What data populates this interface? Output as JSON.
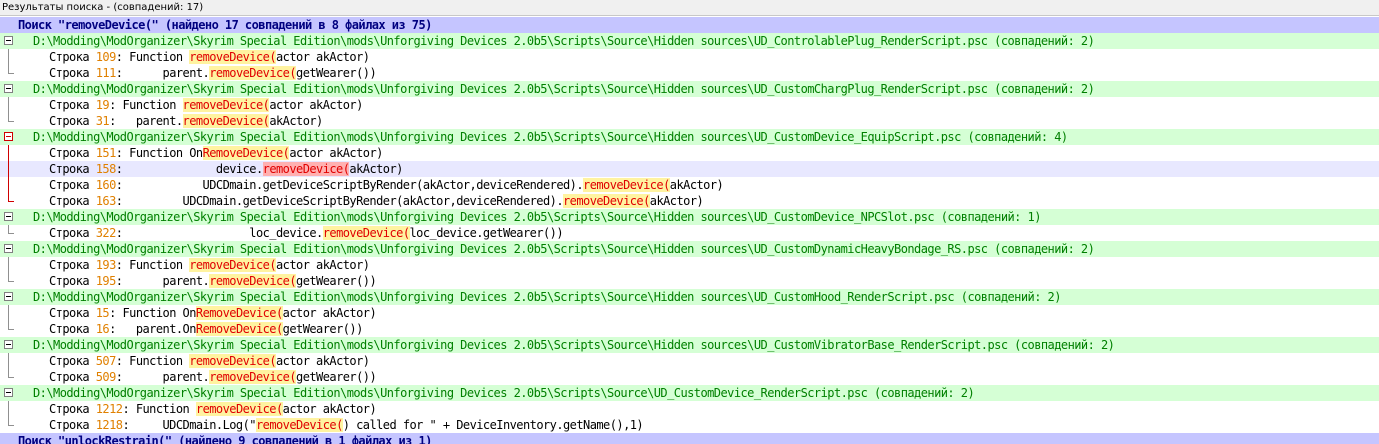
{
  "window": {
    "title": "Результаты поиска - (совпадений: 17)"
  },
  "line_label": "Строка",
  "searches": [
    {
      "header": "Поиск \"removeDevice(\" (найдено 17 совпадений в 8 файлах из 75)",
      "files": [
        {
          "path": "D:\\Modding\\ModOrganizer\\Skyrim Special Edition\\mods\\Unforgiving Devices 2.0b5\\Scripts\\Source\\Hidden sources\\UD_ControlablePlug_RenderScript.psc (совпадений: 2)",
          "hits": [
            {
              "line": "109",
              "pre": "Function ",
              "match": "removeDevice(",
              "post": "actor akActor)"
            },
            {
              "line": "111",
              "pre": "     parent.",
              "match": "removeDevice(",
              "post": "getWearer())"
            }
          ]
        },
        {
          "path": "D:\\Modding\\ModOrganizer\\Skyrim Special Edition\\mods\\Unforgiving Devices 2.0b5\\Scripts\\Source\\Hidden sources\\UD_CustomChargPlug_RenderScript.psc (совпадений: 2)",
          "hits": [
            {
              "line": "19",
              "pre": "Function ",
              "match": "removeDevice(",
              "post": "actor akActor)"
            },
            {
              "line": "31",
              "pre": "  parent.",
              "match": "removeDevice(",
              "post": "akActor)"
            }
          ]
        },
        {
          "path": "D:\\Modding\\ModOrganizer\\Skyrim Special Edition\\mods\\Unforgiving Devices 2.0b5\\Scripts\\Source\\Hidden sources\\UD_CustomDevice_EquipScript.psc (совпадений: 4)",
          "expanded_marker": "red",
          "hits": [
            {
              "line": "151",
              "pre": "Function On",
              "match": "RemoveDevice(",
              "post": "actor akActor)"
            },
            {
              "line": "158",
              "pre": "             device.",
              "match": "removeDevice(",
              "post": "akActor)",
              "selected": true
            },
            {
              "line": "160",
              "pre": "           UDCDmain.getDeviceScriptByRender(akActor,deviceRendered).",
              "match": "removeDevice(",
              "post": "akActor)"
            },
            {
              "line": "163",
              "pre": "        UDCDmain.getDeviceScriptByRender(akActor,deviceRendered).",
              "match": "removeDevice(",
              "post": "akActor)"
            }
          ]
        },
        {
          "path": "D:\\Modding\\ModOrganizer\\Skyrim Special Edition\\mods\\Unforgiving Devices 2.0b5\\Scripts\\Source\\Hidden sources\\UD_CustomDevice_NPCSlot.psc (совпадений: 1)",
          "hits": [
            {
              "line": "322",
              "pre": "                  loc_device.",
              "match": "removeDevice(",
              "post": "loc_device.getWearer())"
            }
          ]
        },
        {
          "path": "D:\\Modding\\ModOrganizer\\Skyrim Special Edition\\mods\\Unforgiving Devices 2.0b5\\Scripts\\Source\\Hidden sources\\UD_CustomDynamicHeavyBondage_RS.psc (совпадений: 2)",
          "hits": [
            {
              "line": "193",
              "pre": "Function ",
              "match": "removeDevice(",
              "post": "actor akActor)"
            },
            {
              "line": "195",
              "pre": "     parent.",
              "match": "removeDevice(",
              "post": "getWearer())"
            }
          ]
        },
        {
          "path": "D:\\Modding\\ModOrganizer\\Skyrim Special Edition\\mods\\Unforgiving Devices 2.0b5\\Scripts\\Source\\Hidden sources\\UD_CustomHood_RenderScript.psc (совпадений: 2)",
          "hits": [
            {
              "line": "15",
              "pre": "Function On",
              "match": "RemoveDevice(",
              "post": "actor akActor)"
            },
            {
              "line": "16",
              "pre": "  parent.On",
              "match": "RemoveDevice(",
              "post": "getWearer())"
            }
          ]
        },
        {
          "path": "D:\\Modding\\ModOrganizer\\Skyrim Special Edition\\mods\\Unforgiving Devices 2.0b5\\Scripts\\Source\\Hidden sources\\UD_CustomVibratorBase_RenderScript.psc (совпадений: 2)",
          "hits": [
            {
              "line": "507",
              "pre": "Function ",
              "match": "removeDevice(",
              "post": "actor akActor)"
            },
            {
              "line": "509",
              "pre": "     parent.",
              "match": "removeDevice(",
              "post": "getWearer())"
            }
          ]
        },
        {
          "path": "D:\\Modding\\ModOrganizer\\Skyrim Special Edition\\mods\\Unforgiving Devices 2.0b5\\Scripts\\Source\\UD_CustomDevice_RenderScript.psc (совпадений: 2)",
          "hits": [
            {
              "line": "1212",
              "pre": "Function ",
              "match": "removeDevice(",
              "post": "actor akActor)"
            },
            {
              "line": "1218",
              "pre": "    UDCDmain.Log(\"",
              "match": "removeDevice(",
              "post": ") called for \" + DeviceInventory.getName(),1)"
            }
          ]
        }
      ]
    },
    {
      "header": "Поиск \"unlockRestrain(\" (найдено 9 совпадений в 1 файлах из 1)",
      "files": []
    }
  ]
}
